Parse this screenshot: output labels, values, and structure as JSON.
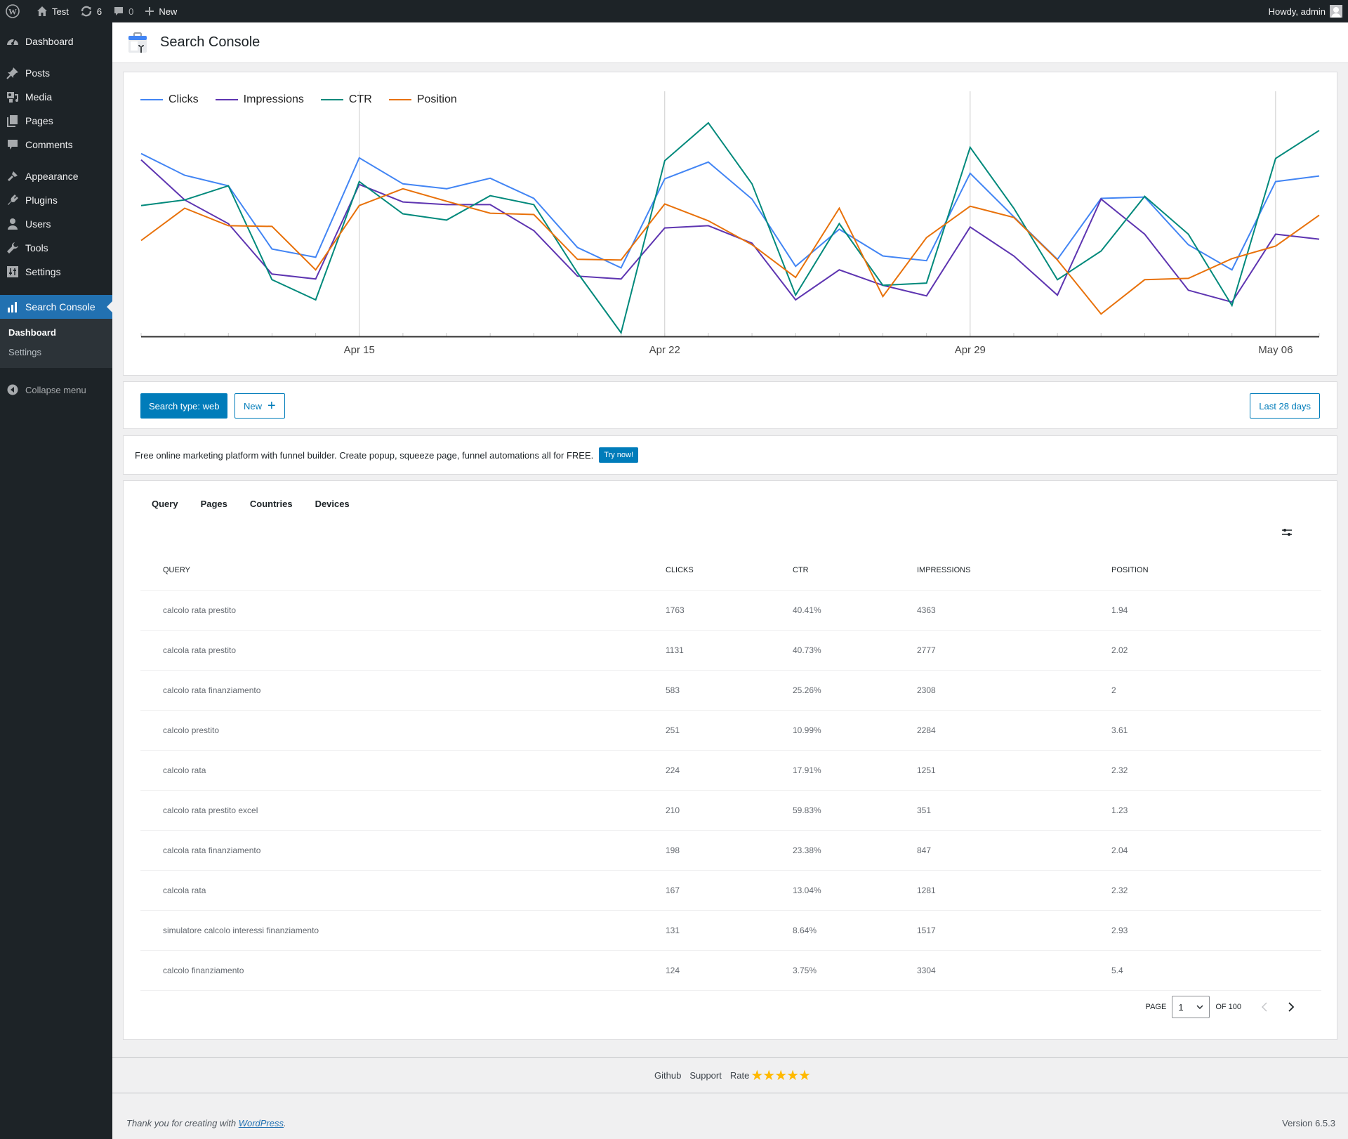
{
  "adminbar": {
    "site_name": "Test",
    "updates_count": "6",
    "comments_count": "0",
    "new_label": "New",
    "greeting": "Howdy, admin"
  },
  "sidebar": {
    "items": [
      {
        "label": "Dashboard",
        "icon": "dashboard-icon"
      },
      {
        "label": "Posts",
        "icon": "pin-icon"
      },
      {
        "label": "Media",
        "icon": "media-icon"
      },
      {
        "label": "Pages",
        "icon": "pages-icon"
      },
      {
        "label": "Comments",
        "icon": "comment-icon"
      },
      {
        "label": "Appearance",
        "icon": "brush-icon"
      },
      {
        "label": "Plugins",
        "icon": "plugin-icon"
      },
      {
        "label": "Users",
        "icon": "user-icon"
      },
      {
        "label": "Tools",
        "icon": "wrench-icon"
      },
      {
        "label": "Settings",
        "icon": "settings-icon"
      },
      {
        "label": "Search Console",
        "icon": "bar-chart-icon"
      }
    ],
    "submenu": [
      "Dashboard",
      "Settings"
    ],
    "collapse_label": "Collapse menu"
  },
  "page": {
    "title": "Search Console"
  },
  "chart_data": {
    "type": "line",
    "title": "",
    "xlabel": "",
    "ylabel": "",
    "y_axis": "none (each series independently scaled; values are normalized index 0-100)",
    "grid": "vertical gridlines at labeled dates",
    "legend_position": "top-left",
    "x_tick_labels": [
      {
        "index": 5,
        "label": "Apr 15"
      },
      {
        "index": 12,
        "label": "Apr 22"
      },
      {
        "index": 19,
        "label": "Apr 29"
      },
      {
        "index": 26,
        "label": "May 06"
      }
    ],
    "x_count": 28,
    "ylim": [
      0,
      100
    ],
    "series": [
      {
        "name": "Clicks",
        "color": "#4285f4",
        "values": [
          81.6,
          71.9,
          67.2,
          39.0,
          35.3,
          79.7,
          68.1,
          65.9,
          70.6,
          61.6,
          39.7,
          30.6,
          70.3,
          77.8,
          61.3,
          31.3,
          47.8,
          35.9,
          33.8,
          72.8,
          53.4,
          34.4,
          61.6,
          62.2,
          40.9,
          29.7,
          69.1,
          71.6
        ]
      },
      {
        "name": "Impressions",
        "color": "#5e35b1",
        "values": [
          78.8,
          60.9,
          50.3,
          27.8,
          25.6,
          67.8,
          60.0,
          58.8,
          58.8,
          47.2,
          26.9,
          25.6,
          48.4,
          49.4,
          41.6,
          16.3,
          29.7,
          22.8,
          18.1,
          48.8,
          35.9,
          18.4,
          61.3,
          45.6,
          20.6,
          15.3,
          45.6,
          43.4
        ]
      },
      {
        "name": "CTR",
        "color": "#00897b",
        "values": [
          58.4,
          60.9,
          67.2,
          25.3,
          16.3,
          69.1,
          54.7,
          51.9,
          62.8,
          58.8,
          28.4,
          1.6,
          78.4,
          95.3,
          68.1,
          18.4,
          50.3,
          22.8,
          23.8,
          84.4,
          57.2,
          25.3,
          38.1,
          62.5,
          45.6,
          13.8,
          79.4,
          91.9
        ]
      },
      {
        "name": "Position",
        "color": "#e8710a",
        "values": [
          42.8,
          57.2,
          49.4,
          49.1,
          29.7,
          58.4,
          65.9,
          60.3,
          55.0,
          54.4,
          34.4,
          34.1,
          59.1,
          51.6,
          40.9,
          26.3,
          57.2,
          17.8,
          44.1,
          58.1,
          53.1,
          34.1,
          10.0,
          25.3,
          25.9,
          34.7,
          40.3,
          54.1
        ]
      }
    ]
  },
  "toolbar": {
    "search_type_label": "Search type: web",
    "new_label": "New",
    "date_range_label": "Last 28 days"
  },
  "promo": {
    "text": "Free online marketing platform with funnel builder. Create popup, squeeze page, funnel automations all for FREE.",
    "button_label": "Try now!"
  },
  "tabs": [
    "Query",
    "Pages",
    "Countries",
    "Devices"
  ],
  "table": {
    "columns": [
      "Query",
      "Clicks",
      "CTR",
      "Impressions",
      "Position"
    ],
    "rows": [
      [
        "calcolo rata prestito",
        "1763",
        "40.41%",
        "4363",
        "1.94"
      ],
      [
        "calcola rata prestito",
        "1131",
        "40.73%",
        "2777",
        "2.02"
      ],
      [
        "calcolo rata finanziamento",
        "583",
        "25.26%",
        "2308",
        "2"
      ],
      [
        "calcolo prestito",
        "251",
        "10.99%",
        "2284",
        "3.61"
      ],
      [
        "calcolo rata",
        "224",
        "17.91%",
        "1251",
        "2.32"
      ],
      [
        "calcolo rata prestito excel",
        "210",
        "59.83%",
        "351",
        "1.23"
      ],
      [
        "calcola rata finanziamento",
        "198",
        "23.38%",
        "847",
        "2.04"
      ],
      [
        "calcola rata",
        "167",
        "13.04%",
        "1281",
        "2.32"
      ],
      [
        "simulatore calcolo interessi finanziamento",
        "131",
        "8.64%",
        "1517",
        "2.93"
      ],
      [
        "calcolo finanziamento",
        "124",
        "3.75%",
        "3304",
        "5.4"
      ]
    ]
  },
  "pagination": {
    "page_label": "PAGE",
    "current_page": "1",
    "of_label": "OF 100"
  },
  "plugin_footer": {
    "github_label": "Github",
    "support_label": "Support",
    "rate_label": "Rate",
    "stars": "★★★★★"
  },
  "wp_footer": {
    "thanks_prefix": "Thank you for creating with ",
    "wordpress_link": "WordPress",
    "thanks_suffix": ".",
    "version": "Version 6.5.3"
  },
  "colors": {
    "admin_dark": "#1d2327",
    "accent_blue": "#2271b1",
    "button_blue": "#007cba",
    "star_yellow": "#ffb900"
  }
}
